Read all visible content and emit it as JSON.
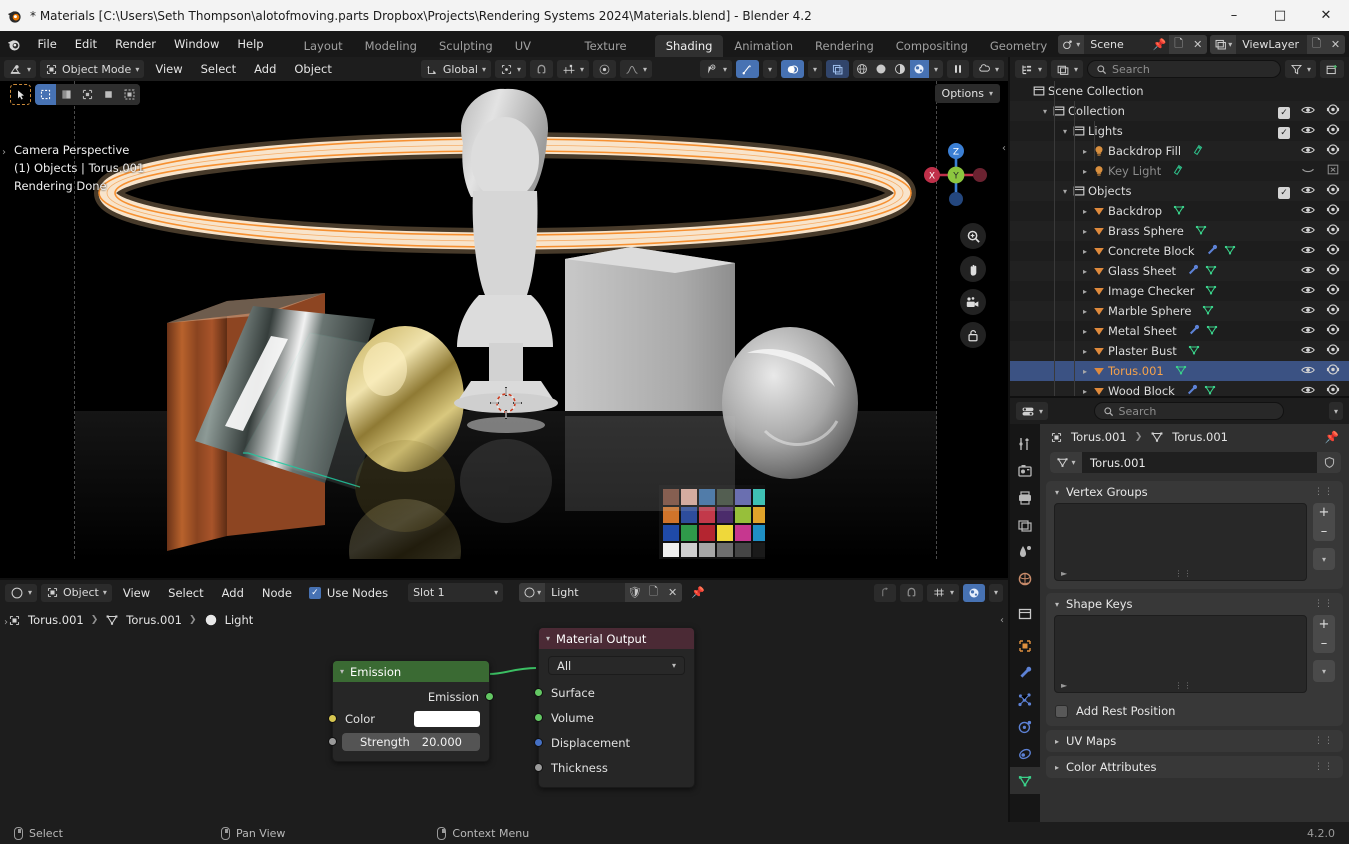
{
  "window": {
    "title": "* Materials [C:\\Users\\Seth Thompson\\alotofmoving.parts Dropbox\\Projects\\Rendering Systems 2024\\Materials.blend] - Blender 4.2",
    "minimize": "–",
    "maximize": "□",
    "close": "✕"
  },
  "topbar": {
    "menus": [
      "File",
      "Edit",
      "Render",
      "Window",
      "Help"
    ],
    "workspaces": [
      {
        "label": "Layout",
        "active": false
      },
      {
        "label": "Modeling",
        "active": false
      },
      {
        "label": "Sculpting",
        "active": false
      },
      {
        "label": "UV Editing",
        "active": false
      },
      {
        "label": "Texture Paint",
        "active": false
      },
      {
        "label": "Shading",
        "active": true
      },
      {
        "label": "Animation",
        "active": false
      },
      {
        "label": "Rendering",
        "active": false
      },
      {
        "label": "Compositing",
        "active": false
      },
      {
        "label": "Geometry N",
        "active": false
      }
    ],
    "scene_name": "Scene",
    "viewlayer_name": "ViewLayer"
  },
  "viewport": {
    "mode": "Object Mode",
    "menus": [
      "View",
      "Select",
      "Add",
      "Object"
    ],
    "transform_orientation": "Global",
    "options_label": "Options",
    "overlay_lines": [
      "Camera Perspective",
      "(1) Objects | Torus.001",
      "Rendering Done"
    ],
    "gizmo_axes": {
      "x": "X",
      "y": "Y",
      "z": "Z"
    }
  },
  "shader_editor": {
    "mode": "Object",
    "menus": [
      "View",
      "Select",
      "Add",
      "Node"
    ],
    "use_nodes_label": "Use Nodes",
    "use_nodes_checked": true,
    "slot": "Slot 1",
    "material_name": "Light",
    "breadcrumb": [
      "Torus.001",
      "Torus.001",
      "Light"
    ],
    "nodes": [
      {
        "name": "Emission",
        "header_color": "#3a6a33",
        "outputs": [
          "Emission"
        ],
        "color_label": "Color",
        "color_value": "#ffffff",
        "strength_label": "Strength",
        "strength_value": "20.000"
      },
      {
        "name": "Material Output",
        "header_color": "#4b2a35",
        "target": "All",
        "inputs": [
          "Surface",
          "Volume",
          "Displacement",
          "Thickness"
        ]
      }
    ]
  },
  "outliner": {
    "search_placeholder": "Search",
    "rows": [
      {
        "label": "Scene Collection",
        "indent": 0,
        "icon": "collection-icon",
        "expand": "",
        "selected": false,
        "dim": false,
        "show_toggles": false,
        "extras": []
      },
      {
        "label": "Collection",
        "indent": 1,
        "icon": "collection-icon",
        "expand": "v",
        "selected": false,
        "dim": false,
        "show_toggles": true,
        "checkbox": true,
        "extras": []
      },
      {
        "label": "Lights",
        "indent": 2,
        "icon": "collection-icon",
        "expand": "v",
        "selected": false,
        "dim": false,
        "show_toggles": true,
        "checkbox": true,
        "extras": []
      },
      {
        "label": "Backdrop Fill",
        "indent": 3,
        "icon": "light-icon",
        "expand": ">",
        "selected": false,
        "dim": false,
        "show_toggles": true,
        "checkbox": false,
        "extras": [
          "lightdata-icon"
        ]
      },
      {
        "label": "Key Light",
        "indent": 3,
        "icon": "light-icon",
        "expand": ">",
        "selected": false,
        "dim": true,
        "show_toggles": true,
        "checkbox": false,
        "extras": [
          "lightdata-icon"
        ],
        "hidden": true
      },
      {
        "label": "Objects",
        "indent": 2,
        "icon": "collection-icon",
        "expand": "v",
        "selected": false,
        "dim": false,
        "show_toggles": true,
        "checkbox": true,
        "extras": []
      },
      {
        "label": "Backdrop",
        "indent": 3,
        "icon": "mesh-object-icon",
        "expand": ">",
        "selected": false,
        "dim": false,
        "show_toggles": true,
        "checkbox": false,
        "extras": [
          "meshdata-icon"
        ]
      },
      {
        "label": "Brass Sphere",
        "indent": 3,
        "icon": "mesh-object-icon",
        "expand": ">",
        "selected": false,
        "dim": false,
        "show_toggles": true,
        "checkbox": false,
        "extras": [
          "meshdata-icon"
        ]
      },
      {
        "label": "Concrete  Block",
        "indent": 3,
        "icon": "mesh-object-icon",
        "expand": ">",
        "selected": false,
        "dim": false,
        "show_toggles": true,
        "checkbox": false,
        "extras": [
          "modifier-icon",
          "meshdata-icon"
        ]
      },
      {
        "label": "Glass Sheet",
        "indent": 3,
        "icon": "mesh-object-icon",
        "expand": ">",
        "selected": false,
        "dim": false,
        "show_toggles": true,
        "checkbox": false,
        "extras": [
          "modifier-icon",
          "meshdata-icon"
        ]
      },
      {
        "label": "Image Checker",
        "indent": 3,
        "icon": "mesh-object-icon",
        "expand": ">",
        "selected": false,
        "dim": false,
        "show_toggles": true,
        "checkbox": false,
        "extras": [
          "meshdata-icon"
        ]
      },
      {
        "label": "Marble Sphere",
        "indent": 3,
        "icon": "mesh-object-icon",
        "expand": ">",
        "selected": false,
        "dim": false,
        "show_toggles": true,
        "checkbox": false,
        "extras": [
          "meshdata-icon"
        ]
      },
      {
        "label": "Metal Sheet",
        "indent": 3,
        "icon": "mesh-object-icon",
        "expand": ">",
        "selected": false,
        "dim": false,
        "show_toggles": true,
        "checkbox": false,
        "extras": [
          "modifier-icon",
          "meshdata-icon"
        ]
      },
      {
        "label": "Plaster Bust",
        "indent": 3,
        "icon": "mesh-object-icon",
        "expand": ">",
        "selected": false,
        "dim": false,
        "show_toggles": true,
        "checkbox": false,
        "extras": [
          "meshdata-icon"
        ]
      },
      {
        "label": "Torus.001",
        "indent": 3,
        "icon": "mesh-object-icon",
        "expand": ">",
        "selected": true,
        "dim": false,
        "show_toggles": true,
        "checkbox": false,
        "extras": [
          "meshdata-icon"
        ]
      },
      {
        "label": "Wood Block",
        "indent": 3,
        "icon": "mesh-object-icon",
        "expand": ">",
        "selected": false,
        "dim": false,
        "show_toggles": true,
        "checkbox": false,
        "extras": [
          "modifier-icon",
          "meshdata-icon"
        ]
      }
    ]
  },
  "properties": {
    "search_placeholder": "Search",
    "breadcrumb_object": "Torus.001",
    "breadcrumb_data": "Torus.001",
    "datablock_name": "Torus.001",
    "panels": [
      {
        "title": "Vertex Groups",
        "open": true,
        "type": "list"
      },
      {
        "title": "Shape Keys",
        "open": true,
        "type": "list",
        "checkbox_label": "Add Rest Position"
      },
      {
        "title": "UV Maps",
        "open": false,
        "type": "plain"
      },
      {
        "title": "Color Attributes",
        "open": false,
        "type": "plain"
      }
    ],
    "add_btn": "+",
    "remove_btn": "–"
  },
  "statusbar": {
    "items": [
      {
        "label": "Select",
        "mouse": "left"
      },
      {
        "label": "Pan View",
        "mouse": "middle"
      },
      {
        "label": "Context Menu",
        "mouse": "right"
      }
    ],
    "version": "4.2.0"
  },
  "colors": {
    "accent_blue": "#4772b3",
    "selected_orange": "#f5a24b",
    "emission_green": "#3a6a33",
    "output_maroon": "#4b2a35",
    "mesh_icon_orange": "#e08a3c",
    "data_icon_green": "#3ad18a"
  }
}
